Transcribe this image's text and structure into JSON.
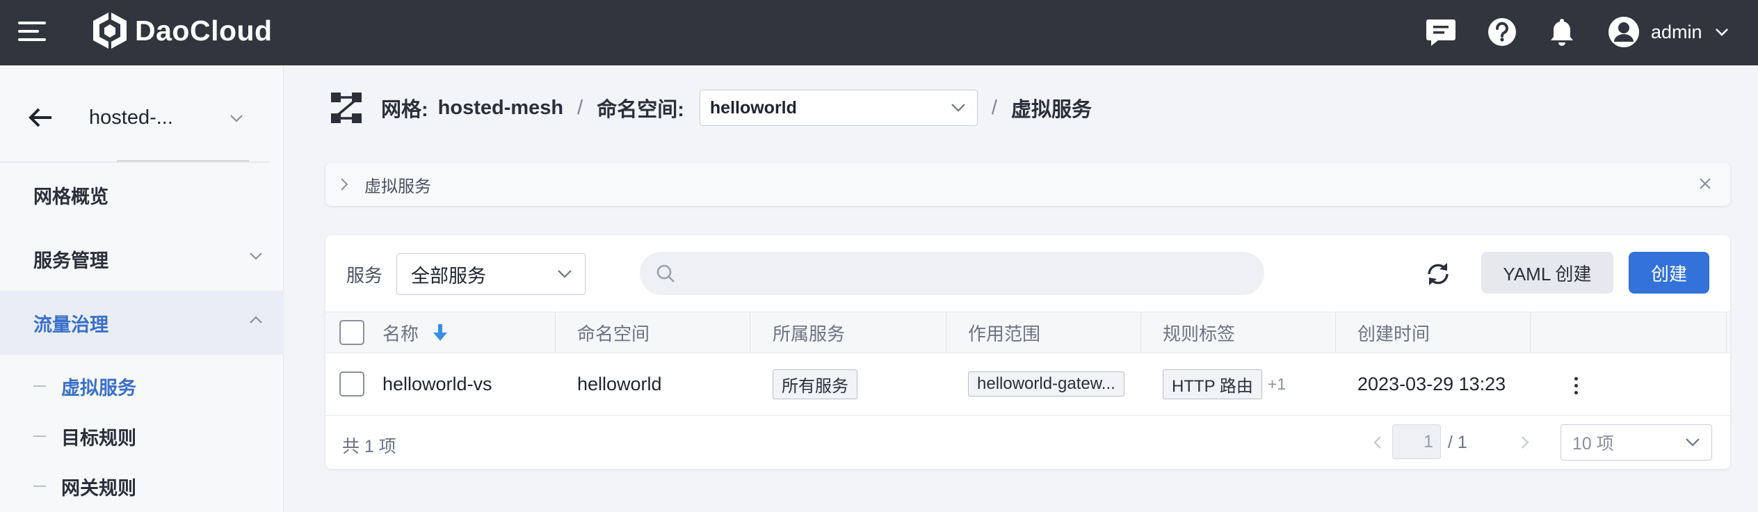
{
  "topbar": {
    "brand": "DaoCloud",
    "username": "admin",
    "icons": [
      "menu-icon",
      "message-icon",
      "help-icon",
      "bell-icon",
      "user-avatar-icon",
      "chevron-down-icon"
    ]
  },
  "sidebar": {
    "mesh_name": "hosted-...",
    "items": [
      {
        "label": "网格概览"
      },
      {
        "label": "服务管理"
      },
      {
        "label": "流量治理"
      }
    ],
    "sub_items": [
      {
        "label": "虚拟服务",
        "active": true
      },
      {
        "label": "目标规则",
        "active": false
      },
      {
        "label": "网关规则",
        "active": false
      }
    ]
  },
  "breadcrumb": {
    "mesh_label": "网格:",
    "mesh_value": "hosted-mesh",
    "separator": "/",
    "namespace_label": "命名空间:",
    "namespace_value": "helloworld",
    "page": "虚拟服务"
  },
  "info_panel": {
    "title": "虚拟服务"
  },
  "toolbar": {
    "filter_label": "服务",
    "filter_value": "全部服务",
    "search_placeholder": "",
    "yaml_create_label": "YAML 创建",
    "create_label": "创建"
  },
  "table": {
    "columns": [
      "名称",
      "命名空间",
      "所属服务",
      "作用范围",
      "规则标签",
      "创建时间"
    ],
    "rows": [
      {
        "name": "helloworld-vs",
        "namespace": "helloworld",
        "service": "所有服务",
        "scope": "helloworld-gatew...",
        "rule_tag": "HTTP 路由",
        "rule_tag_more": "+1",
        "created": "2023-03-29 13:23"
      }
    ]
  },
  "pagination": {
    "total_text": "共 1 项",
    "current_page": "1",
    "page_total": "/ 1",
    "page_size": "10 项"
  },
  "colors": {
    "topbar_bg": "#31353e",
    "accent": "#3372d8",
    "active_nav": "#3a70c9",
    "page_bg": "#f2f4f8"
  }
}
